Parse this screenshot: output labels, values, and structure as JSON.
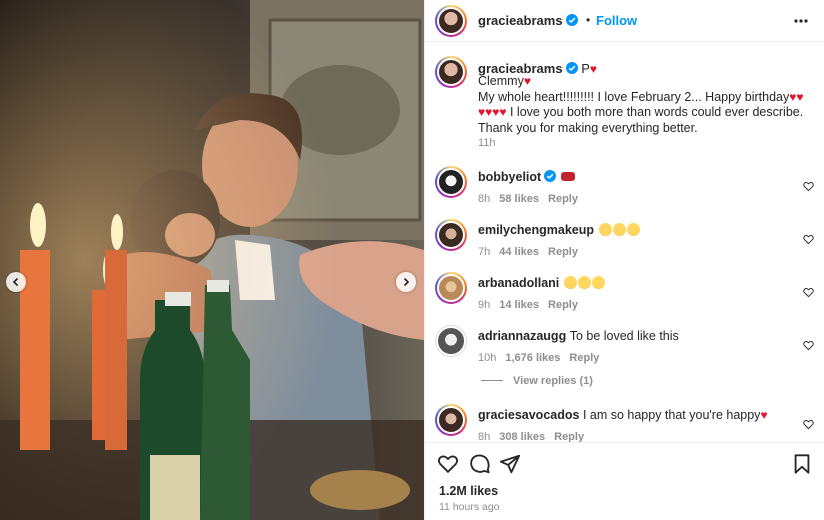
{
  "post": {
    "username": "gracieabrams",
    "follow_label": "Follow",
    "separator": "•",
    "caption": {
      "username": "gracieabrams",
      "line1_prefix": "P",
      "line2": "Clemmy",
      "line3": "My whole heart!!!!!!!!! I love February 2... Happy birthday",
      "line4_suffix": "I love you both more than words could ever describe. Thank you for making everything better.",
      "time": "11h"
    },
    "likes": "1.2M likes",
    "posted": "11 hours ago"
  },
  "comments": [
    {
      "username": "bobbyeliot",
      "text": "",
      "emoji": "red",
      "time": "8h",
      "likes": "58 likes",
      "reply": "Reply"
    },
    {
      "username": "emilychengmakeup",
      "text": "",
      "emoji": "yellow3",
      "time": "7h",
      "likes": "44 likes",
      "reply": "Reply"
    },
    {
      "username": "arbanadollani",
      "text": "",
      "emoji": "yellow3",
      "time": "9h",
      "likes": "14 likes",
      "reply": "Reply"
    },
    {
      "username": "adriannazaugg",
      "text": "To be loved like this",
      "time": "10h",
      "likes": "1,676 likes",
      "reply": "Reply"
    },
    {
      "username": "graciesavocados",
      "text": "I am so happy that you're happy",
      "time": "8h",
      "likes": "308 likes",
      "reply": "Reply"
    }
  ],
  "view_replies": "View replies (1)",
  "icons": {
    "verified": "verified-badge-icon",
    "more": "more-options-icon",
    "like": "heart-outline-icon",
    "comment": "comment-icon",
    "share": "send-icon",
    "save": "bookmark-icon",
    "prev": "chevron-left-icon",
    "next": "chevron-right-icon"
  },
  "colors": {
    "accent": "#0095f6",
    "heart": "#e0162b",
    "muted": "#8e8e8e",
    "text": "#262626"
  }
}
